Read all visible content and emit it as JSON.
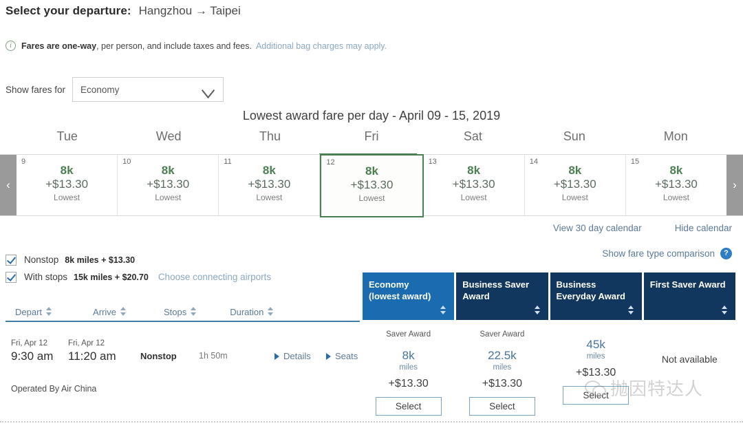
{
  "header": {
    "title": "Select your departure:",
    "route": "Hangzhou → Taipei"
  },
  "info": {
    "icon": "info-icon",
    "strong": "Fares are one-way",
    "rest": ", per person, and include taxes and fees.",
    "link": "Additional bag charges may apply."
  },
  "show_fares": {
    "label": "Show fares for",
    "selected": "Economy",
    "chevron": "chevron-down-icon"
  },
  "calendar": {
    "title": "Lowest award fare per day - April 09 - 15, 2019",
    "prev_arrow": "‹",
    "next_arrow": "›",
    "weekdays": [
      "Tue",
      "Wed",
      "Thu",
      "Fri",
      "Sat",
      "Sun",
      "Mon"
    ],
    "days": [
      {
        "day": "9",
        "miles": "8k",
        "cash": "+$13.30",
        "tag": "Lowest",
        "selected": false
      },
      {
        "day": "10",
        "miles": "8k",
        "cash": "+$13.30",
        "tag": "Lowest",
        "selected": false
      },
      {
        "day": "11",
        "miles": "8k",
        "cash": "+$13.30",
        "tag": "Lowest",
        "selected": false
      },
      {
        "day": "12",
        "miles": "8k",
        "cash": "+$13.30",
        "tag": "Lowest",
        "selected": true
      },
      {
        "day": "13",
        "miles": "8k",
        "cash": "+$13.30",
        "tag": "Lowest",
        "selected": false
      },
      {
        "day": "14",
        "miles": "8k",
        "cash": "+$13.30",
        "tag": "Lowest",
        "selected": false
      },
      {
        "day": "15",
        "miles": "8k",
        "cash": "+$13.30",
        "tag": "Lowest",
        "selected": false
      }
    ],
    "view_30_day": "View 30 day calendar",
    "hide_calendar": "Hide calendar",
    "compare_label": "Show fare type comparison",
    "compare_icon": "question-mark-icon"
  },
  "filters": [
    {
      "name": "Nonstop",
      "value": "8k miles + $13.30",
      "checked": true,
      "link": ""
    },
    {
      "name": "With stops",
      "value": "15k miles + $20.70",
      "checked": true,
      "link": "Choose connecting airports"
    }
  ],
  "table_headers": [
    {
      "label": "Depart"
    },
    {
      "label": "Arrive"
    },
    {
      "label": "Stops"
    },
    {
      "label": "Duration"
    }
  ],
  "fare_columns": [
    {
      "line1": "Economy",
      "line2": "(lowest award)",
      "active": true
    },
    {
      "line1": "Business Saver",
      "line2": "Award",
      "active": false
    },
    {
      "line1": "Business",
      "line2": "Everyday Award",
      "active": false
    },
    {
      "line1": "First Saver Award",
      "line2": "",
      "active": false
    }
  ],
  "flight": {
    "depart_date": "Fri, Apr 12",
    "depart_time": "9:30 am",
    "arrive_date": "Fri, Apr 12",
    "arrive_time": "11:20 am",
    "stops": "Nonstop",
    "duration": "1h 50m",
    "details_link": "Details",
    "seats_link": "Seats",
    "operated_by": "Operated By Air China",
    "fares": [
      {
        "award_type": "Saver Award",
        "miles": "8k",
        "unit": "miles",
        "cash": "+$13.30",
        "button": "Select",
        "available": true
      },
      {
        "award_type": "Saver Award",
        "miles": "22.5k",
        "unit": "miles",
        "cash": "+$13.30",
        "button": "Select",
        "available": true
      },
      {
        "award_type": "",
        "miles": "45k",
        "unit": "miles",
        "cash": "+$13.30",
        "button": "Select",
        "available": true
      },
      {
        "award_type": "",
        "miles": "",
        "unit": "",
        "cash": "",
        "button": "",
        "available": false,
        "unavailable_text": "Not available"
      }
    ]
  },
  "watermark": {
    "logo": "wechat-logo-icon",
    "text": "抛因特达人"
  },
  "colors": {
    "accent_green": "#4a7f52",
    "link_blue": "#5b7a99",
    "header_navy": "#12375f",
    "header_active_blue": "#1a6bb0"
  }
}
